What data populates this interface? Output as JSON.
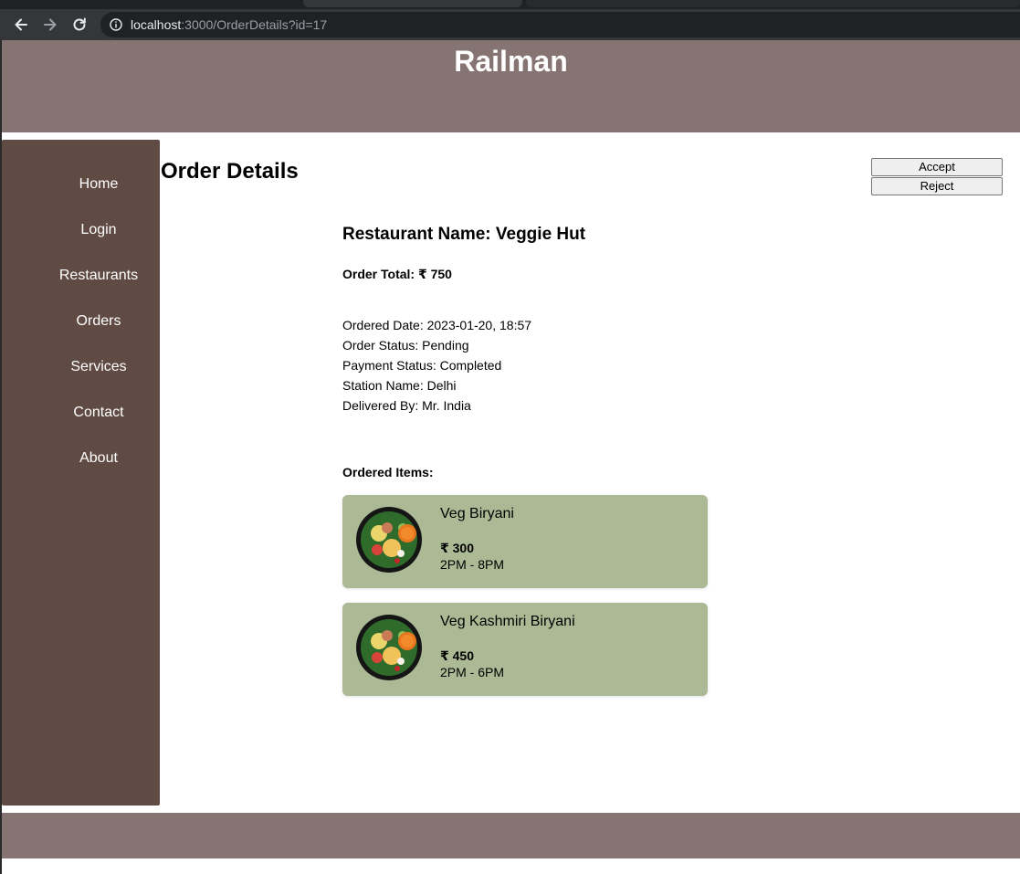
{
  "browser": {
    "url_host": "localhost",
    "url_rest": ":3000/OrderDetails?id=17"
  },
  "header": {
    "title": "Railman"
  },
  "sidebar": {
    "items": [
      {
        "label": "Home"
      },
      {
        "label": "Login"
      },
      {
        "label": "Restaurants"
      },
      {
        "label": "Orders"
      },
      {
        "label": "Services"
      },
      {
        "label": "Contact"
      },
      {
        "label": "About"
      }
    ]
  },
  "main": {
    "title": "Order Details",
    "accept_label": "Accept",
    "reject_label": "Reject",
    "restaurant": "Restaurant Name: Veggie Hut",
    "order_total": "Order Total: ₹ 750",
    "ordered_date": "Ordered Date: 2023-01-20, 18:57",
    "order_status": "Order Status: Pending",
    "payment_status": "Payment Status: Completed",
    "station_name": "Station Name: Delhi",
    "delivered_by": "Delivered By: Mr. India",
    "items_heading": "Ordered Items:",
    "items": [
      {
        "name": "Veg Biryani",
        "price": "₹ 300",
        "time": "2PM - 8PM"
      },
      {
        "name": "Veg Kashmiri Biryani",
        "price": "₹ 450",
        "time": "2PM - 6PM"
      }
    ]
  },
  "colors": {
    "header_bg": "#867472",
    "sidebar_bg": "#5f4b44",
    "card_bg": "#abb994"
  }
}
